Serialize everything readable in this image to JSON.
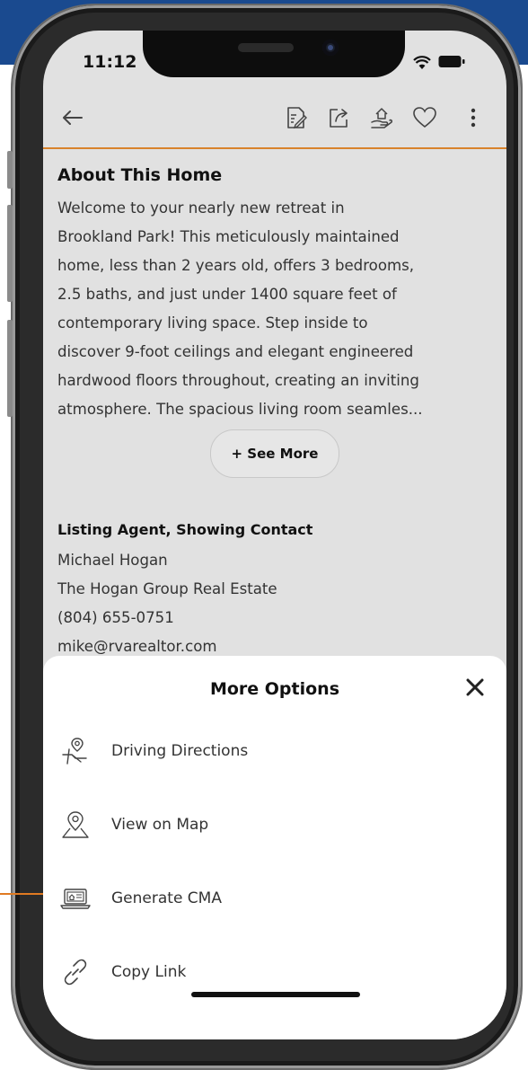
{
  "status_bar": {
    "time": "11:12"
  },
  "toolbar": {
    "back_icon": "arrow-left-icon",
    "actions": [
      "notes-icon",
      "share-icon",
      "offer-hand-icon",
      "heart-icon",
      "more-vertical-icon"
    ]
  },
  "about": {
    "title": "About This Home",
    "lines": [
      "Welcome to your nearly new retreat in",
      "Brookland Park! This meticulously maintained",
      "home, less than 2 years old, offers 3 bedrooms,",
      "2.5 baths, and just under 1400 square feet of",
      "contemporary living space. Step inside to",
      "discover 9-foot ceilings and elegant engineered",
      "hardwood floors throughout, creating an inviting",
      "atmosphere. The spacious living room seamles..."
    ],
    "see_more": "+ See More"
  },
  "agent": {
    "title": "Listing Agent, Showing Contact",
    "name": "Michael Hogan",
    "company": "The Hogan Group Real Estate",
    "phone": "(804) 655-0751",
    "email": "mike@rvarealtor.com"
  },
  "sheet": {
    "title": "More Options",
    "options": [
      {
        "label": "Driving Directions",
        "icon": "directions-pin-icon"
      },
      {
        "label": "View on Map",
        "icon": "map-pin-icon"
      },
      {
        "label": "Generate CMA",
        "icon": "cma-laptop-icon"
      },
      {
        "label": "Copy Link",
        "icon": "link-icon"
      }
    ]
  },
  "colors": {
    "accent": "#d9832b",
    "brand_blue": "#1a4a8f",
    "screen_bg": "#e1e1e1"
  }
}
